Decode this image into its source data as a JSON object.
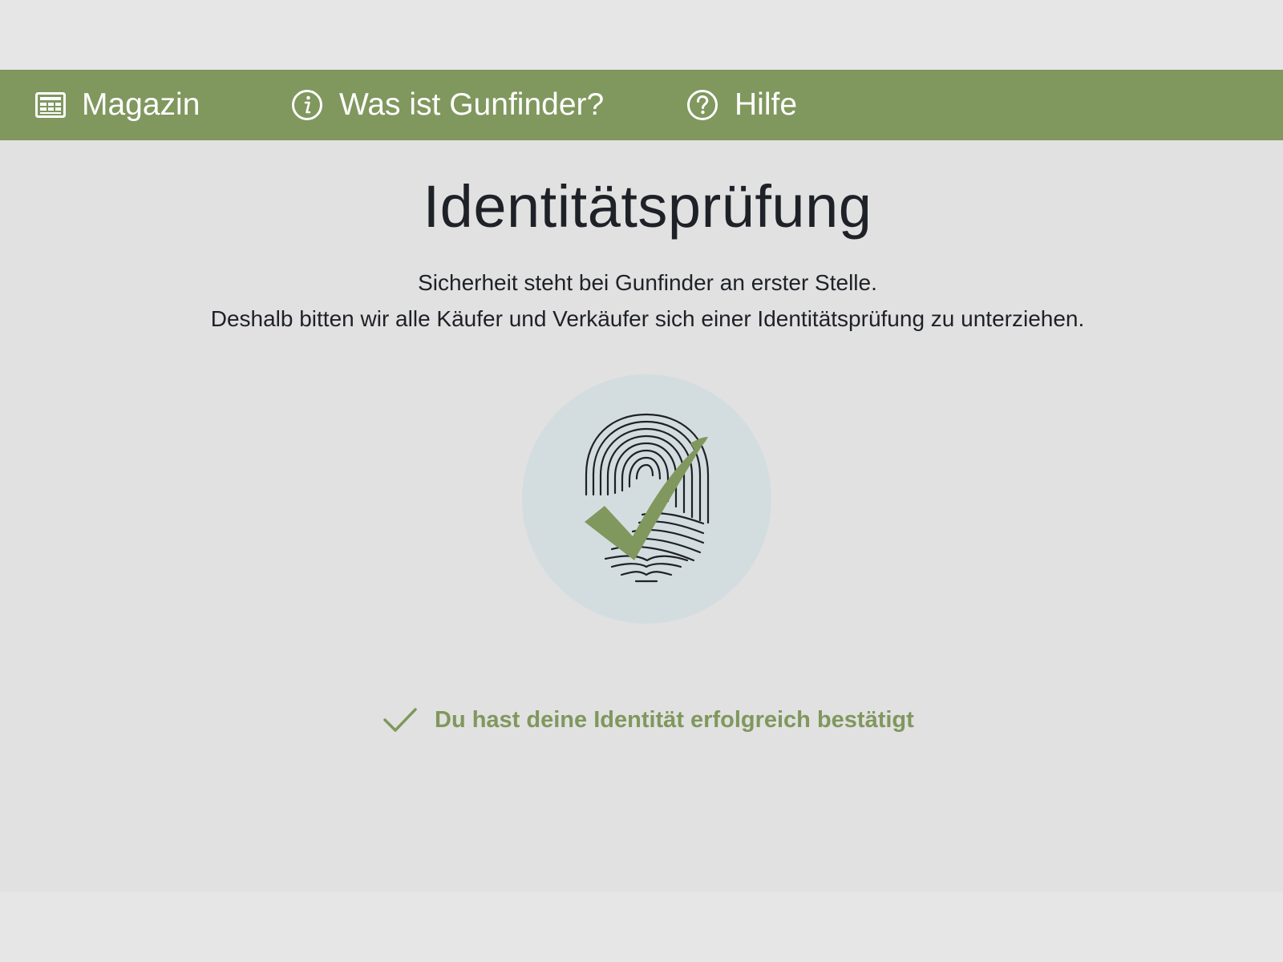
{
  "nav": {
    "items": [
      {
        "label": "Magazin",
        "icon": "newspaper-icon"
      },
      {
        "label": "Was ist Gunfinder?",
        "icon": "info-circle-icon"
      },
      {
        "label": "Hilfe",
        "icon": "help-circle-icon"
      }
    ]
  },
  "main": {
    "title": "Identitätsprüfung",
    "subtitle_line1": "Sicherheit steht bei Gunfinder an erster Stelle.",
    "subtitle_line2": "Deshalb bitten wir alle Käufer und Verkäufer sich einer Identitätsprüfung zu unterziehen.",
    "illustration_icon": "fingerprint-check-icon",
    "status_icon": "checkmark-icon",
    "status_text": "Du hast deine Identität erfolgreich bestätigt"
  },
  "colors": {
    "accent": "#80975e",
    "badge_bg": "#d3dde0",
    "text": "#1e2127",
    "background": "#e1e1e1"
  }
}
